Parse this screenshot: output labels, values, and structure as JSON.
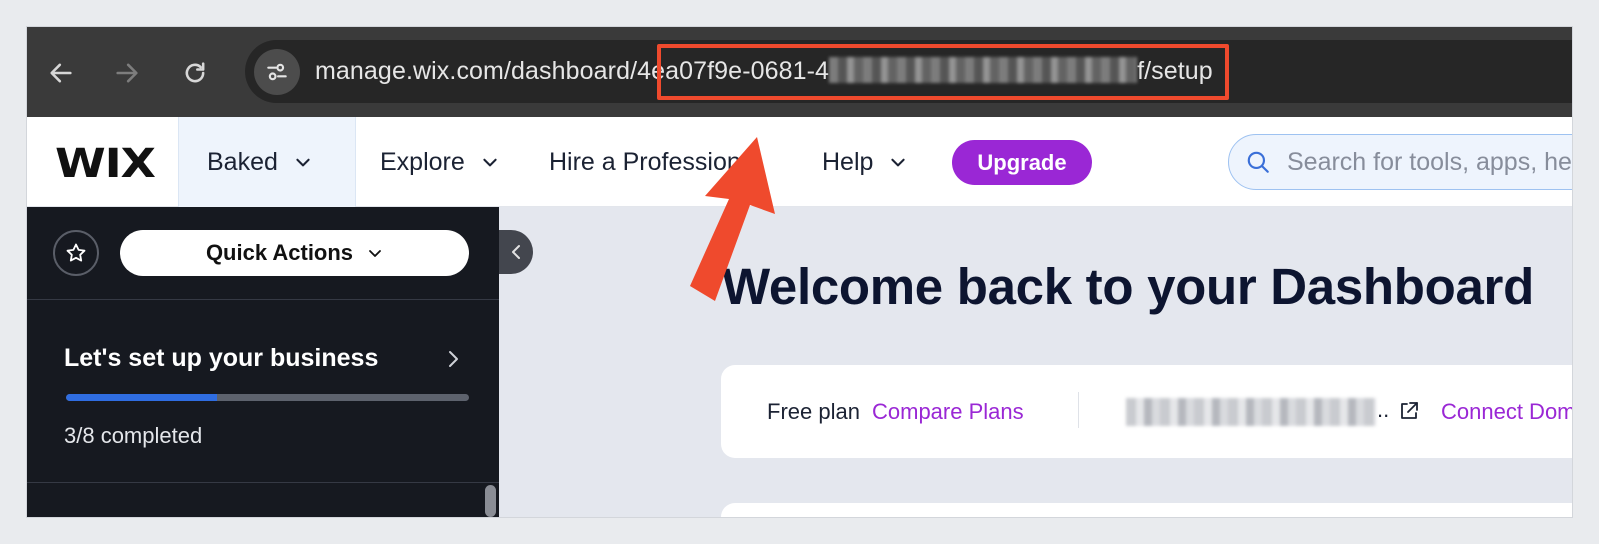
{
  "browser": {
    "url_prefix": "manage.wix.com/dashboard/4ea07f9e-0681-4",
    "url_suffix": "f/setup",
    "icons": {
      "back": "arrow-left-icon",
      "forward": "arrow-right-icon",
      "reload": "reload-icon",
      "site_info": "tune-icon"
    }
  },
  "header": {
    "logo": "WIX",
    "site_name": "Baked",
    "menu": {
      "explore": "Explore",
      "hire": "Hire a Professional",
      "help": "Help"
    },
    "upgrade_label": "Upgrade",
    "search_placeholder": "Search for tools, apps, help & more..."
  },
  "sidebar": {
    "quick_actions_label": "Quick Actions",
    "setup_title": "Let's set up your business",
    "progress_text": "3/8 completed",
    "progress_fraction": 0.375
  },
  "main": {
    "welcome": "Welcome back to your Dashboard",
    "plan_label": "Free plan",
    "compare_plans": "Compare Plans",
    "domain_ellipsis": "..",
    "connect_label": "Connect Domain"
  },
  "colors": {
    "accent_purple": "#9a27d5",
    "annotation_red": "#ef4a2d",
    "progress_blue": "#2f6de1",
    "sidebar_bg": "#161920"
  }
}
